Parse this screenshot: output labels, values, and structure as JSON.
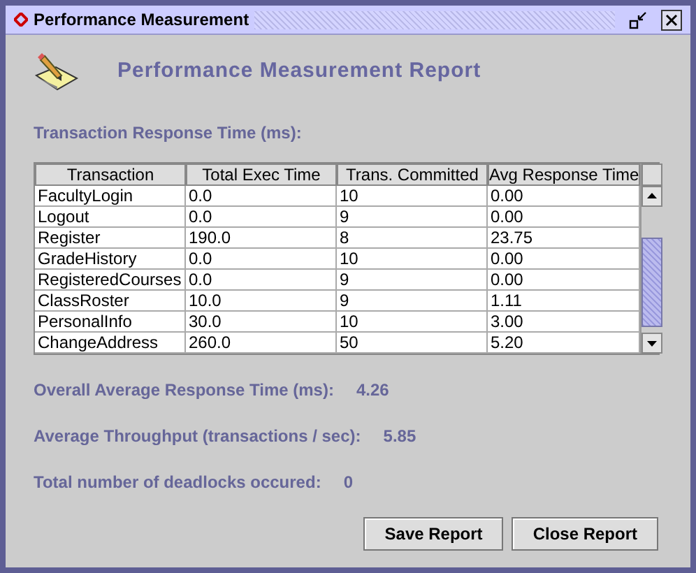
{
  "window": {
    "title": "Performance Measurement"
  },
  "heading": "Performance Measurement Report",
  "table_title": "Transaction Response Time (ms):",
  "table": {
    "columns": [
      "Transaction",
      "Total Exec Time",
      "Trans. Committed",
      "Avg Response Time"
    ],
    "rows": [
      [
        "FacultyLogin",
        "0.0",
        "10",
        "0.00"
      ],
      [
        "Logout",
        "0.0",
        "9",
        "0.00"
      ],
      [
        "Register",
        "190.0",
        "8",
        "23.75"
      ],
      [
        "GradeHistory",
        "0.0",
        "10",
        "0.00"
      ],
      [
        "RegisteredCourses",
        "0.0",
        "9",
        "0.00"
      ],
      [
        "ClassRoster",
        "10.0",
        "9",
        "1.11"
      ],
      [
        "PersonalInfo",
        "30.0",
        "10",
        "3.00"
      ],
      [
        "ChangeAddress",
        "260.0",
        "50",
        "5.20"
      ]
    ]
  },
  "stats": [
    {
      "label": "Overall Average Response Time (ms):",
      "value": "4.26"
    },
    {
      "label": "Average Throughput (transactions / sec):",
      "value": "5.85"
    },
    {
      "label": "Total number of deadlocks occured:",
      "value": "0"
    }
  ],
  "buttons": [
    "Save Report",
    "Close Report"
  ]
}
